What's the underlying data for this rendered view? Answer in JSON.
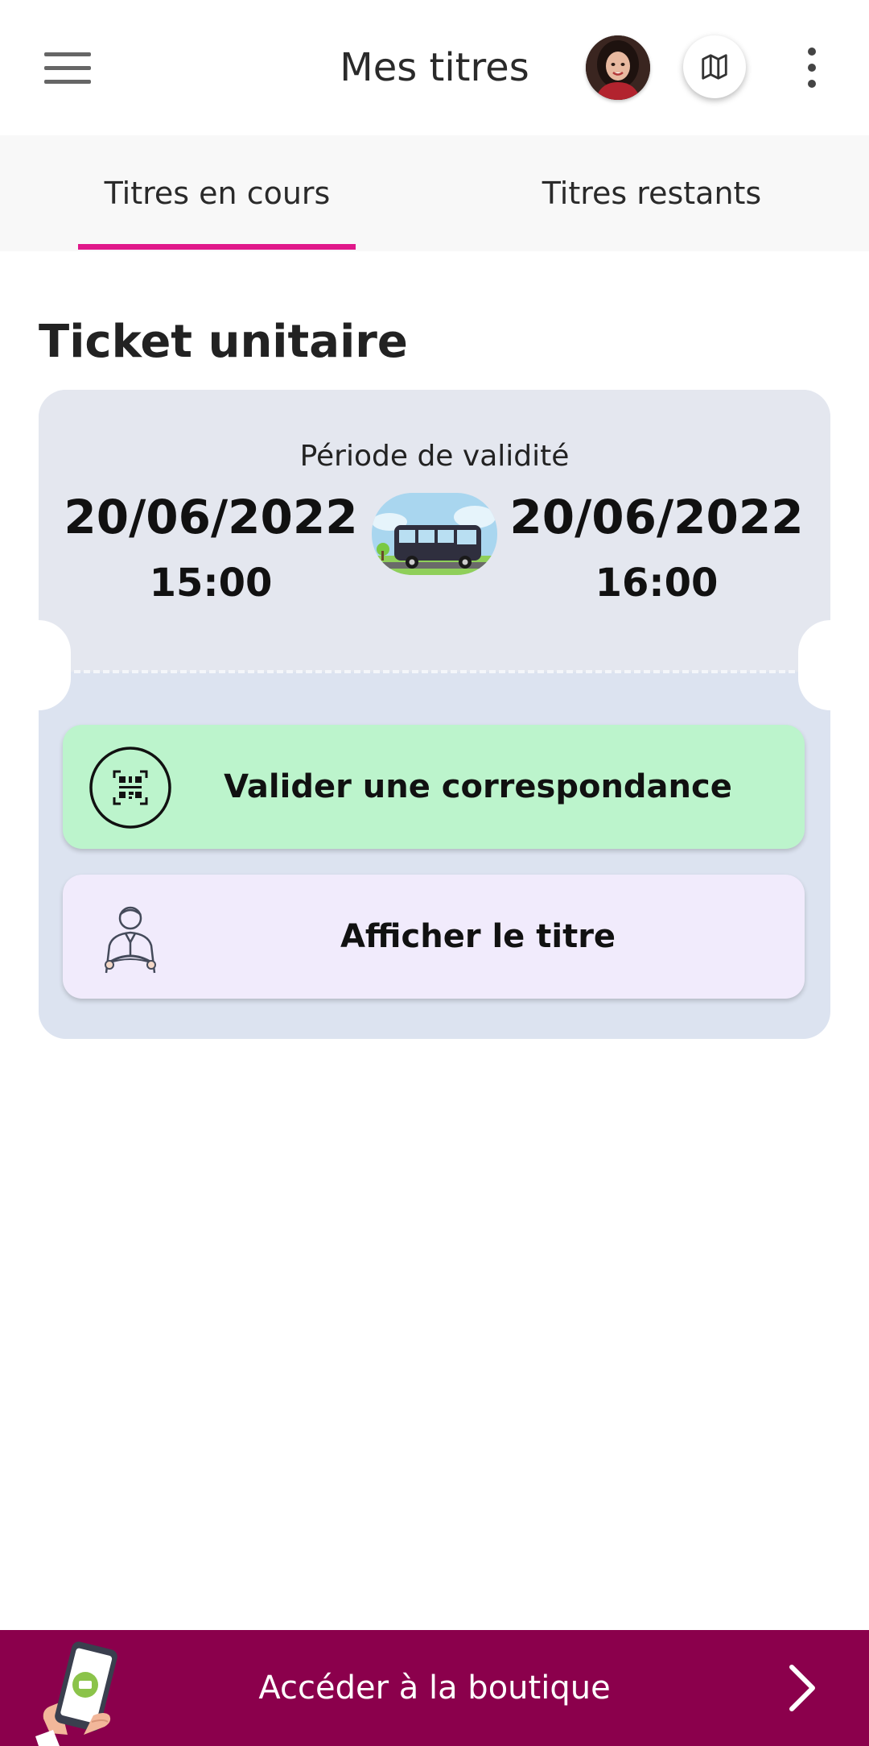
{
  "header": {
    "title": "Mes titres",
    "menu_icon": "hamburger-menu-icon",
    "avatar_icon": "user-avatar",
    "map_icon": "map-icon",
    "more_icon": "more-vertical-icon"
  },
  "tabs": [
    {
      "label": "Titres en cours",
      "active": true
    },
    {
      "label": "Titres restants",
      "active": false
    }
  ],
  "ticket": {
    "section_title": "Ticket unitaire",
    "validity_label": "Période de validité",
    "start_date": "20/06/2022",
    "start_time": "15:00",
    "end_date": "20/06/2022",
    "end_time": "16:00",
    "transport_icon": "bus-icon",
    "actions": {
      "validate": {
        "label": "Valider une correspondance",
        "icon": "qr-code-icon"
      },
      "show": {
        "label": "Afficher le titre",
        "icon": "driver-icon"
      }
    }
  },
  "shop": {
    "label": "Accéder à la boutique",
    "icon": "phone-shop-icon",
    "chevron_icon": "chevron-right-icon"
  },
  "colors": {
    "accent_pink": "#e0188a",
    "shop_bar": "#8b004c",
    "validate_bg": "#bcf4cc",
    "show_bg": "#f1ebfc",
    "ticket_bg": "#dce3f0"
  }
}
